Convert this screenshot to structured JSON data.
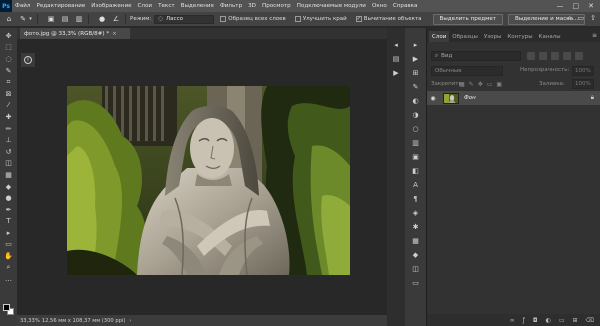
{
  "menubar": {
    "logo": "Ps",
    "items": [
      "Файл",
      "Редактирование",
      "Изображение",
      "Слои",
      "Текст",
      "Выделение",
      "Фильтр",
      "3D",
      "Просмотр",
      "Подключаемые модули",
      "Окно",
      "Справка"
    ],
    "minimize": "—",
    "maximize": "□",
    "close": "✕"
  },
  "options": {
    "mode_label": "Режим:",
    "mode_value": "Лассо",
    "sample_all_layers": "Образец всех слоев",
    "enhance_edge": "Улучшить край",
    "subtract_object": "Вычитание объекта",
    "subtract_checked": "✓",
    "select_subject": "Выделить предмет",
    "select_mask": "Выделение и маска..."
  },
  "document": {
    "tab_title": "фото.jpg @ 33,3% (RGB/8#) *",
    "tab_close": "×",
    "info": "i"
  },
  "status": {
    "text": "33,33%",
    "doc_size": "12,56 мм x 108,37 мм (300 ppi)",
    "arrow": "›"
  },
  "panel": {
    "tabs": [
      "Слои",
      "Образцы",
      "Узоры",
      "Контуры",
      "Каналы"
    ],
    "active_tab": "Слои",
    "menu": "≡",
    "search_placeholder": "Вид",
    "blend_mode": "Обычные",
    "opacity_label": "Непрозрачность:",
    "opacity_value": "100%",
    "lock_label": "Закрепить:",
    "fill_label": "Заливка:",
    "fill_value": "100%",
    "layer_name": "Фон"
  },
  "colors": {
    "accent": "#31a8ff",
    "menubar": "#535353",
    "panel_bg": "#323232",
    "canvas_bg": "#282828"
  }
}
